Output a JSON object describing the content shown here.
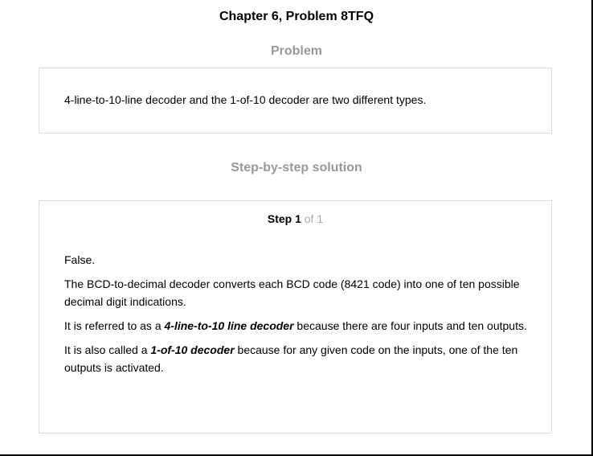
{
  "chapter_title": "Chapter 6, Problem 8TFQ",
  "problem": {
    "heading": "Problem",
    "text": "4-line-to-10-line decoder and the 1-of-10 decoder are two different types."
  },
  "solution": {
    "heading": "Step-by-step solution",
    "step": {
      "label": "Step 1",
      "count": " of 1",
      "answer": "False.",
      "p1": "The BCD-to-decimal decoder converts each BCD code (8421 code) into one of ten possible decimal digit indications.",
      "p2_pre": "It is referred to as a ",
      "p2_em": "4-line-to-10 line decoder",
      "p2_post": " because there are four inputs and ten outputs.",
      "p3_pre": "It is also called a ",
      "p3_em": "1-of-10 decoder",
      "p3_post": " because for any given code on the inputs, one of the ten outputs is activated."
    }
  }
}
